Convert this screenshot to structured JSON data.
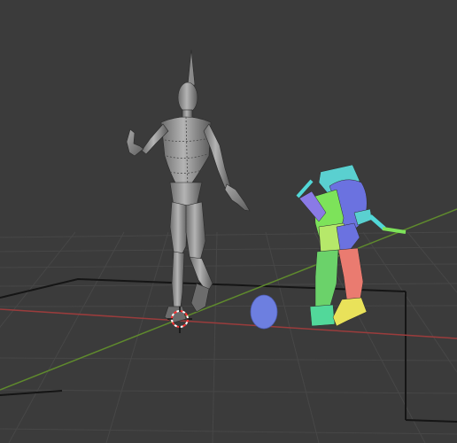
{
  "app": {
    "name": "3D Viewport"
  },
  "viewport": {
    "background_color": "#3b3b3b",
    "grid_color": "#454545",
    "grid_major_color": "#141414",
    "x_axis_color": "#9a3c3c",
    "y_axis_color": "#5f8a2d"
  },
  "objects": [
    {
      "name": "armature-mesh-figure",
      "shading": "solid-metallic-grey",
      "color": "#8e8e8e"
    },
    {
      "name": "segmented-colored-figure",
      "shading": "normal-colors",
      "colors": [
        "#5ad0d0",
        "#6b72e0",
        "#7de35a",
        "#ea7b70",
        "#e9e25a",
        "#52d89a"
      ]
    },
    {
      "name": "ball",
      "color": "#6d7fe0"
    },
    {
      "name": "3d-cursor",
      "icon": "3d-cursor-icon",
      "colors": [
        "#ff3333",
        "#ffffff"
      ]
    }
  ]
}
